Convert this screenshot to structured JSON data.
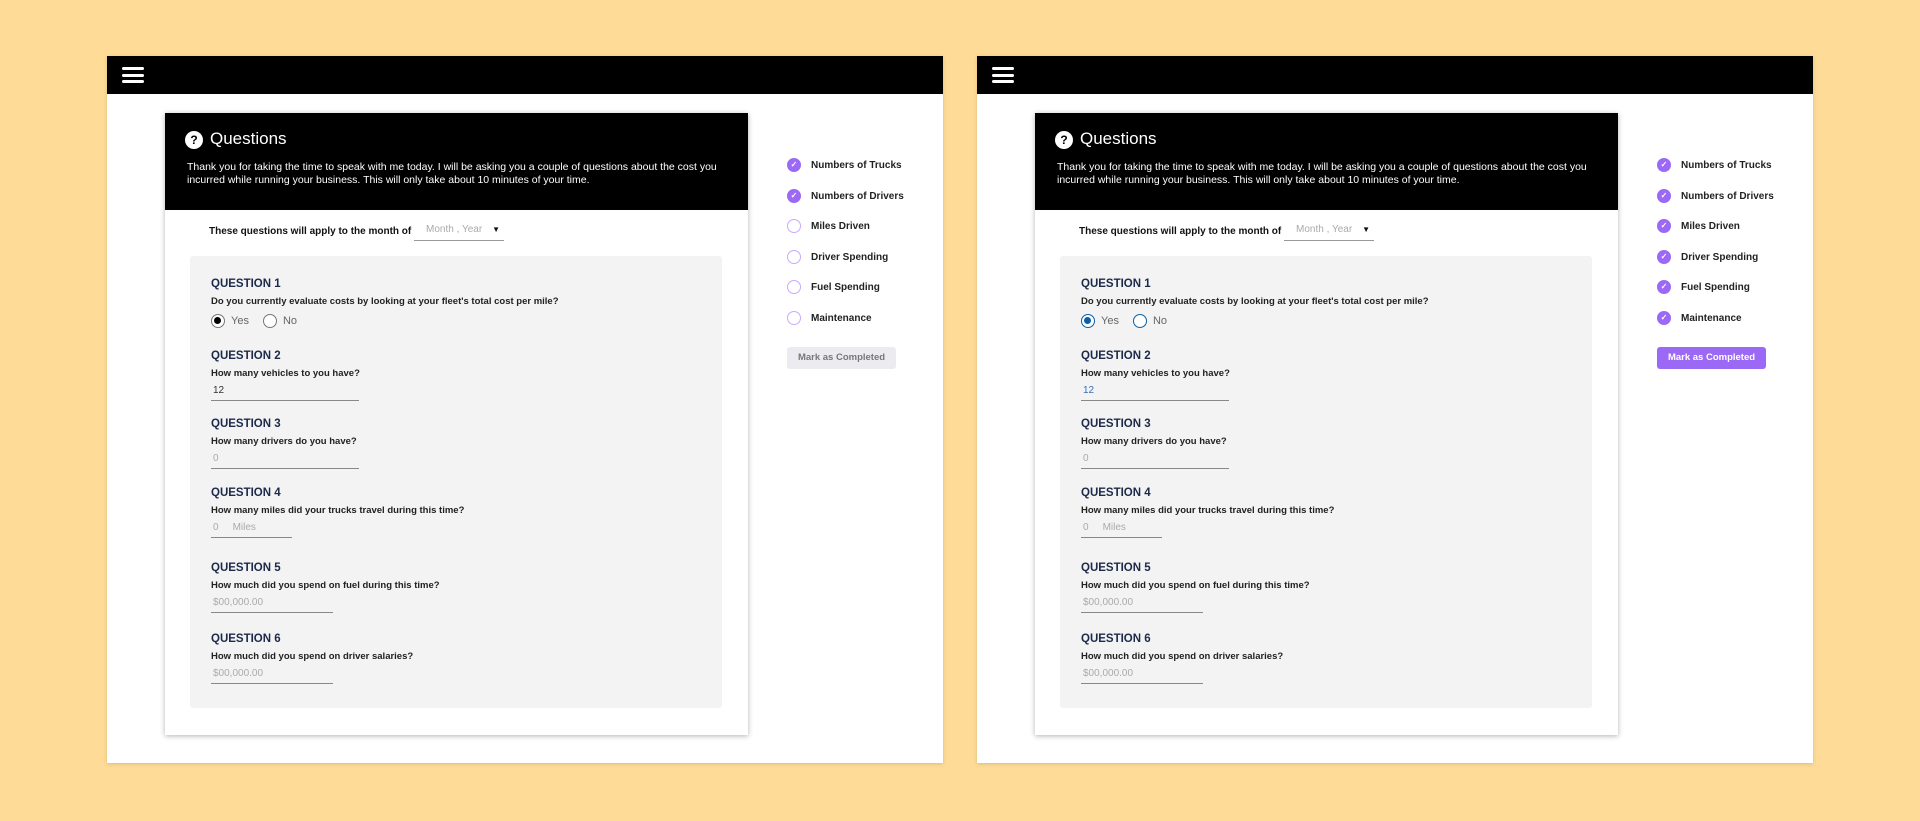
{
  "colors": {
    "accent": "#9b69f5",
    "accent_light": "#c9a8ff",
    "radio_blue": "#0a5fa8",
    "header": "#000000",
    "background": "#fedc97"
  },
  "screens": [
    {
      "name": "partial",
      "title": "Questions",
      "description": "Thank you for taking the time to speak with me today.  I will be asking you a couple of questions about the cost you incurred while running your business.  This will only take about 10 minutes of your time.",
      "month_label": "These questions will apply to the month of",
      "month_placeholder": "Month , Year",
      "questions": [
        {
          "title": "QUESTION 1",
          "text": "Do you currently evaluate costs by looking at your fleet's total cost per mile?",
          "type": "radio",
          "options": [
            "Yes",
            "No"
          ],
          "selected": "Yes"
        },
        {
          "title": "QUESTION 2",
          "text": "How many vehicles to you have?",
          "value": "12"
        },
        {
          "title": "QUESTION 3",
          "text": "How many drivers do you have?",
          "placeholder": "0"
        },
        {
          "title": "QUESTION 4",
          "text": "How many miles did your trucks travel during this time?",
          "placeholder": "0",
          "unit": "Miles"
        },
        {
          "title": "QUESTION 5",
          "text": "How much did you spend on fuel during this time?",
          "placeholder": "$00,000.00"
        },
        {
          "title": "QUESTION 6",
          "text": "How much did you spend on driver salaries?",
          "placeholder": "$00,000.00"
        }
      ],
      "checklist": [
        {
          "label": "Numbers of Trucks",
          "done": true
        },
        {
          "label": "Numbers of Drivers",
          "done": true
        },
        {
          "label": "Miles Driven",
          "done": false
        },
        {
          "label": "Driver Spending",
          "done": false
        },
        {
          "label": "Fuel Spending",
          "done": false
        },
        {
          "label": "Maintenance",
          "done": false
        }
      ],
      "mark_label": "Mark as Completed",
      "mark_enabled": false
    },
    {
      "name": "complete",
      "title": "Questions",
      "description": "Thank you for taking the time to speak with me today.  I will be asking you a couple of questions about the cost you incurred while running your business.  This will only take about 10 minutes of your time.",
      "month_label": "These questions will apply to the month of",
      "month_placeholder": "Month , Year",
      "questions": [
        {
          "title": "QUESTION 1",
          "text": "Do you currently evaluate costs by looking at your fleet's total cost per mile?",
          "type": "radio",
          "options": [
            "Yes",
            "No"
          ],
          "selected": "Yes"
        },
        {
          "title": "QUESTION 2",
          "text": "How many vehicles to you have?",
          "value": "12"
        },
        {
          "title": "QUESTION 3",
          "text": "How many drivers do you have?",
          "placeholder": "0"
        },
        {
          "title": "QUESTION 4",
          "text": "How many miles did your trucks travel during this time?",
          "placeholder": "0",
          "unit": "Miles"
        },
        {
          "title": "QUESTION 5",
          "text": "How much did you spend on fuel during this time?",
          "placeholder": "$00,000.00"
        },
        {
          "title": "QUESTION 6",
          "text": "How much did you spend on driver salaries?",
          "placeholder": "$00,000.00"
        }
      ],
      "checklist": [
        {
          "label": "Numbers of Trucks",
          "done": true
        },
        {
          "label": "Numbers of Drivers",
          "done": true
        },
        {
          "label": "Miles Driven",
          "done": true
        },
        {
          "label": "Driver Spending",
          "done": true
        },
        {
          "label": "Fuel Spending",
          "done": true
        },
        {
          "label": "Maintenance",
          "done": true
        }
      ],
      "mark_label": "Mark as Completed",
      "mark_enabled": true
    }
  ]
}
